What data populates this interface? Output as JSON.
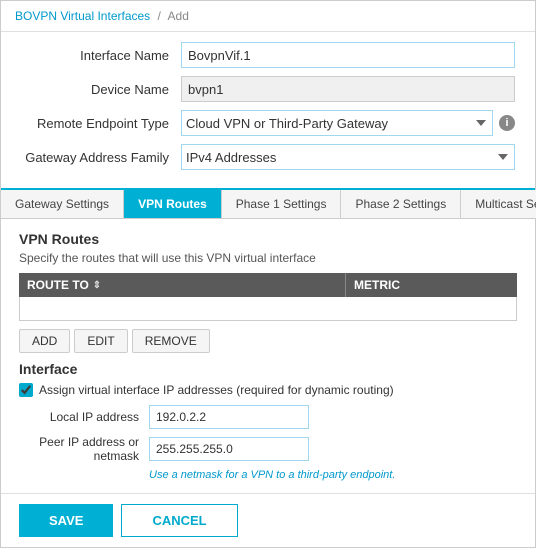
{
  "breadcrumb": {
    "parent": "BOVPN Virtual Interfaces",
    "separator": "/",
    "current": "Add"
  },
  "form": {
    "interface_name_label": "Interface Name",
    "interface_name_value": "BovpnVif.1",
    "device_name_label": "Device Name",
    "device_name_value": "bvpn1",
    "remote_endpoint_label": "Remote Endpoint Type",
    "remote_endpoint_value": "Cloud VPN or Third-Party Gateway",
    "gateway_address_label": "Gateway Address Family",
    "gateway_address_value": "IPv4 Addresses"
  },
  "tabs": [
    {
      "id": "gateway",
      "label": "Gateway Settings",
      "active": false
    },
    {
      "id": "vpn-routes",
      "label": "VPN Routes",
      "active": true
    },
    {
      "id": "phase1",
      "label": "Phase 1 Settings",
      "active": false
    },
    {
      "id": "phase2",
      "label": "Phase 2 Settings",
      "active": false
    },
    {
      "id": "multicast",
      "label": "Multicast Settings",
      "active": false
    }
  ],
  "vpn_routes": {
    "section_title": "VPN Routes",
    "section_desc": "Specify the routes that will use this VPN virtual interface",
    "col_route": "ROUTE TO",
    "col_metric": "METRIC",
    "buttons": {
      "add": "ADD",
      "edit": "EDIT",
      "remove": "REMOVE"
    }
  },
  "interface": {
    "title": "Interface",
    "checkbox_label": "Assign virtual interface IP addresses (required for dynamic routing)",
    "local_ip_label": "Local IP address",
    "local_ip_value": "192.0.2.2",
    "peer_label": "Peer IP address or\nnetmask",
    "peer_value": "255.255.255.0",
    "hint": "Use a netmask for a VPN to a third-party endpoint."
  },
  "footer": {
    "save_label": "SAVE",
    "cancel_label": "CANCEL"
  }
}
